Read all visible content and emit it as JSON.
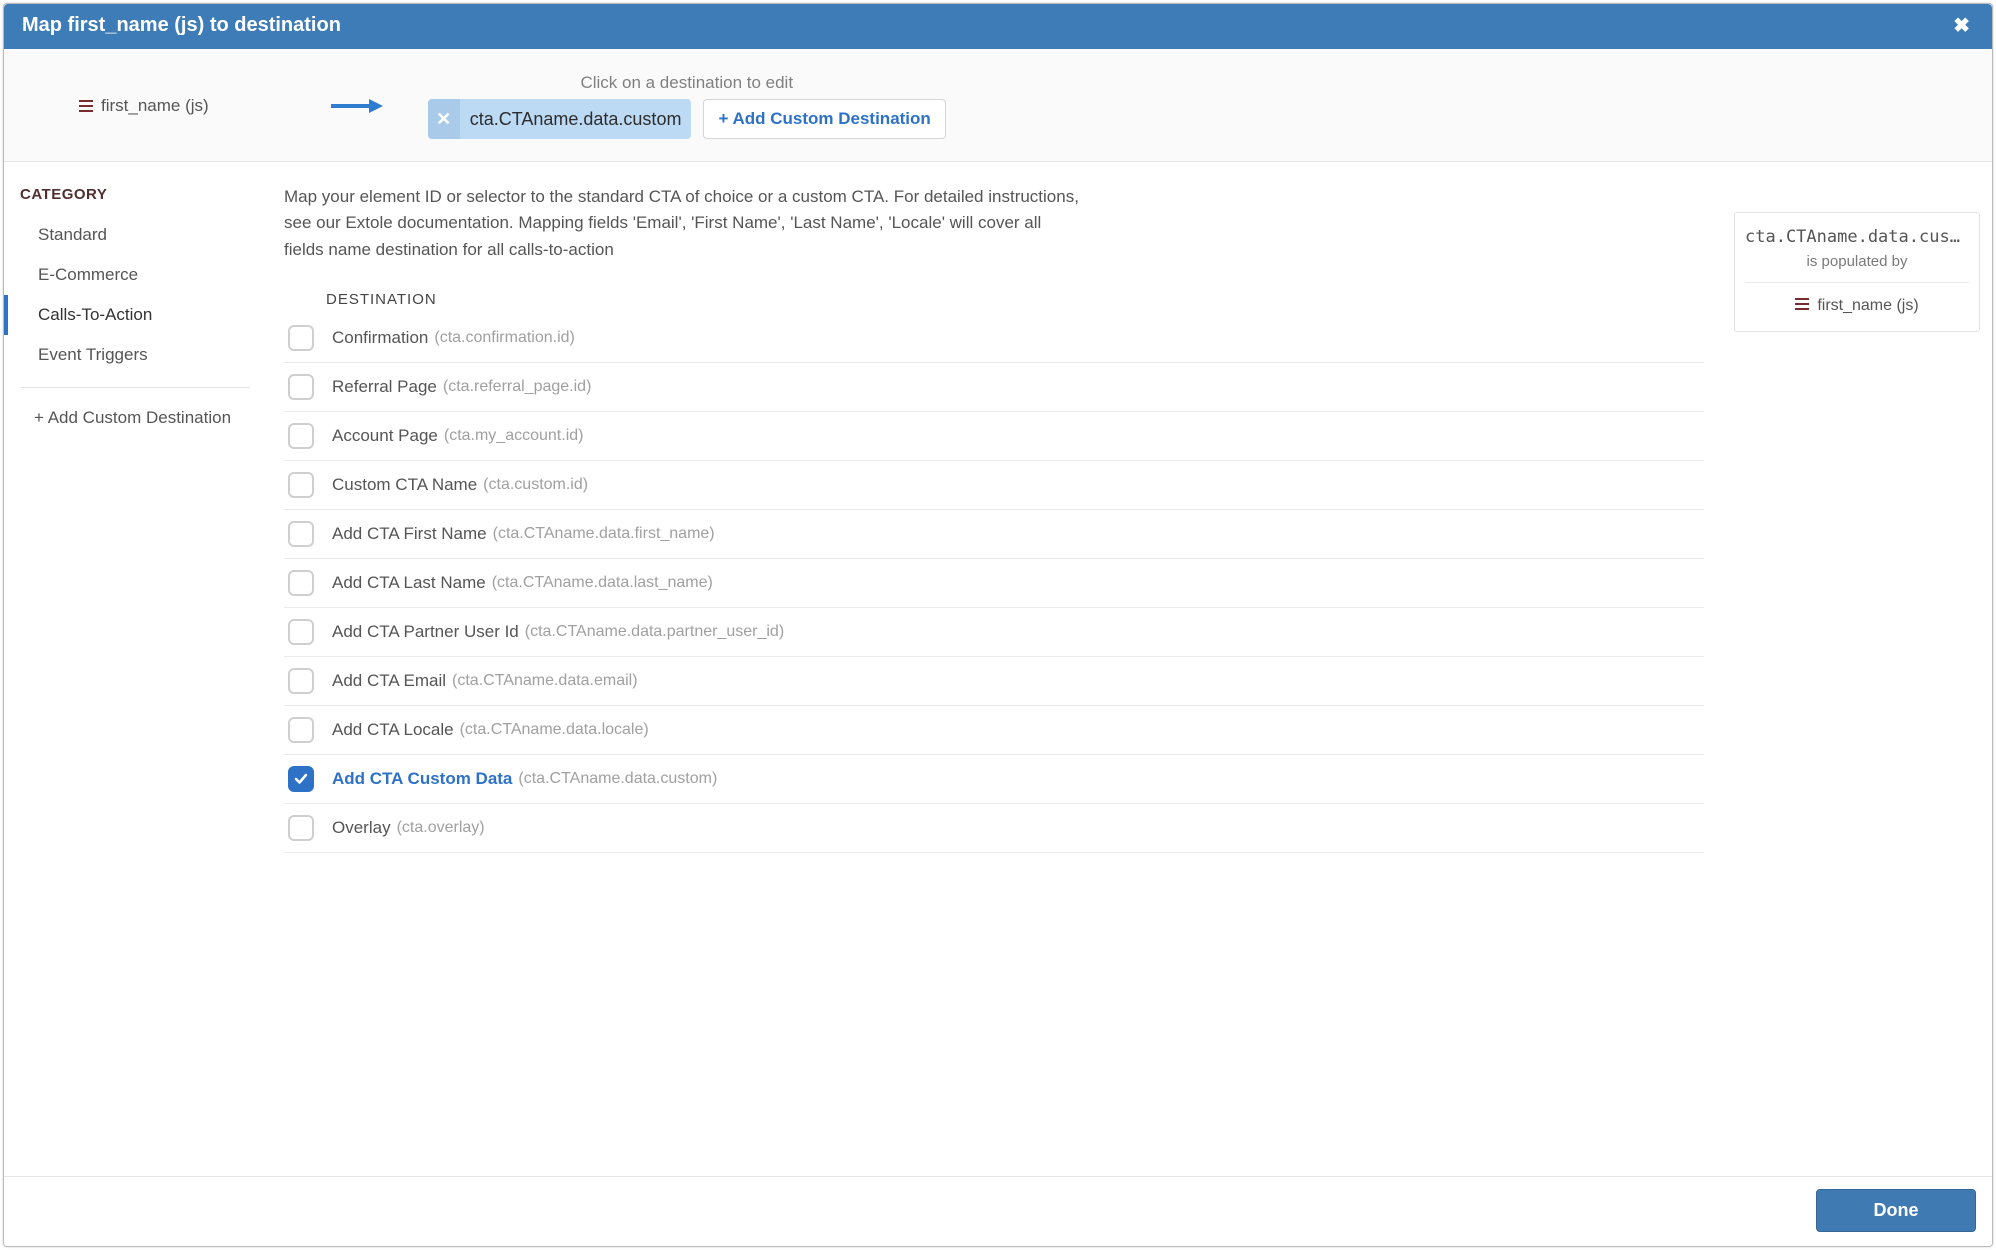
{
  "header": {
    "title": "Map first_name (js) to destination",
    "close_glyph": "✖"
  },
  "mapping": {
    "source_label": "first_name (js)",
    "hint_text": "Click on a destination to edit",
    "chip_label": "cta.CTAname.data.custom",
    "chip_close": "✕",
    "add_custom_destination": "+ Add Custom Destination"
  },
  "sidebar": {
    "category_heading": "CATEGORY",
    "items": [
      {
        "label": "Standard",
        "active": false
      },
      {
        "label": "E-Commerce",
        "active": false
      },
      {
        "label": "Calls-To-Action",
        "active": true
      },
      {
        "label": "Event Triggers",
        "active": false
      }
    ],
    "add_custom": "+ Add Custom Destination"
  },
  "main": {
    "instructions": "Map your element ID or selector to the standard CTA of choice or a custom CTA. For detailed instructions, see our Extole documentation. Mapping fields 'Email', 'First Name', 'Last Name', 'Locale' will cover all fields name destination for all calls-to-action",
    "destination_heading": "DESTINATION",
    "destinations": [
      {
        "label": "Confirmation",
        "code": "(cta.confirmation.id)",
        "checked": false
      },
      {
        "label": "Referral Page",
        "code": "(cta.referral_page.id)",
        "checked": false
      },
      {
        "label": "Account Page",
        "code": "(cta.my_account.id)",
        "checked": false
      },
      {
        "label": "Custom CTA Name",
        "code": "(cta.custom.id)",
        "checked": false
      },
      {
        "label": "Add CTA First Name",
        "code": "(cta.CTAname.data.first_name)",
        "checked": false
      },
      {
        "label": "Add CTA Last Name",
        "code": "(cta.CTAname.data.last_name)",
        "checked": false
      },
      {
        "label": "Add CTA Partner User Id",
        "code": "(cta.CTAname.data.partner_user_id)",
        "checked": false
      },
      {
        "label": "Add CTA Email",
        "code": "(cta.CTAname.data.email)",
        "checked": false
      },
      {
        "label": "Add CTA Locale",
        "code": "(cta.CTAname.data.locale)",
        "checked": false
      },
      {
        "label": "Add CTA Custom Data",
        "code": "(cta.CTAname.data.custom)",
        "checked": true
      },
      {
        "label": "Overlay",
        "code": "(cta.overlay)",
        "checked": false
      }
    ]
  },
  "info": {
    "code": "cta.CTAname.data.cust…",
    "populated_by": "is populated by",
    "source": "first_name (js)"
  },
  "footer": {
    "done_label": "Done"
  }
}
